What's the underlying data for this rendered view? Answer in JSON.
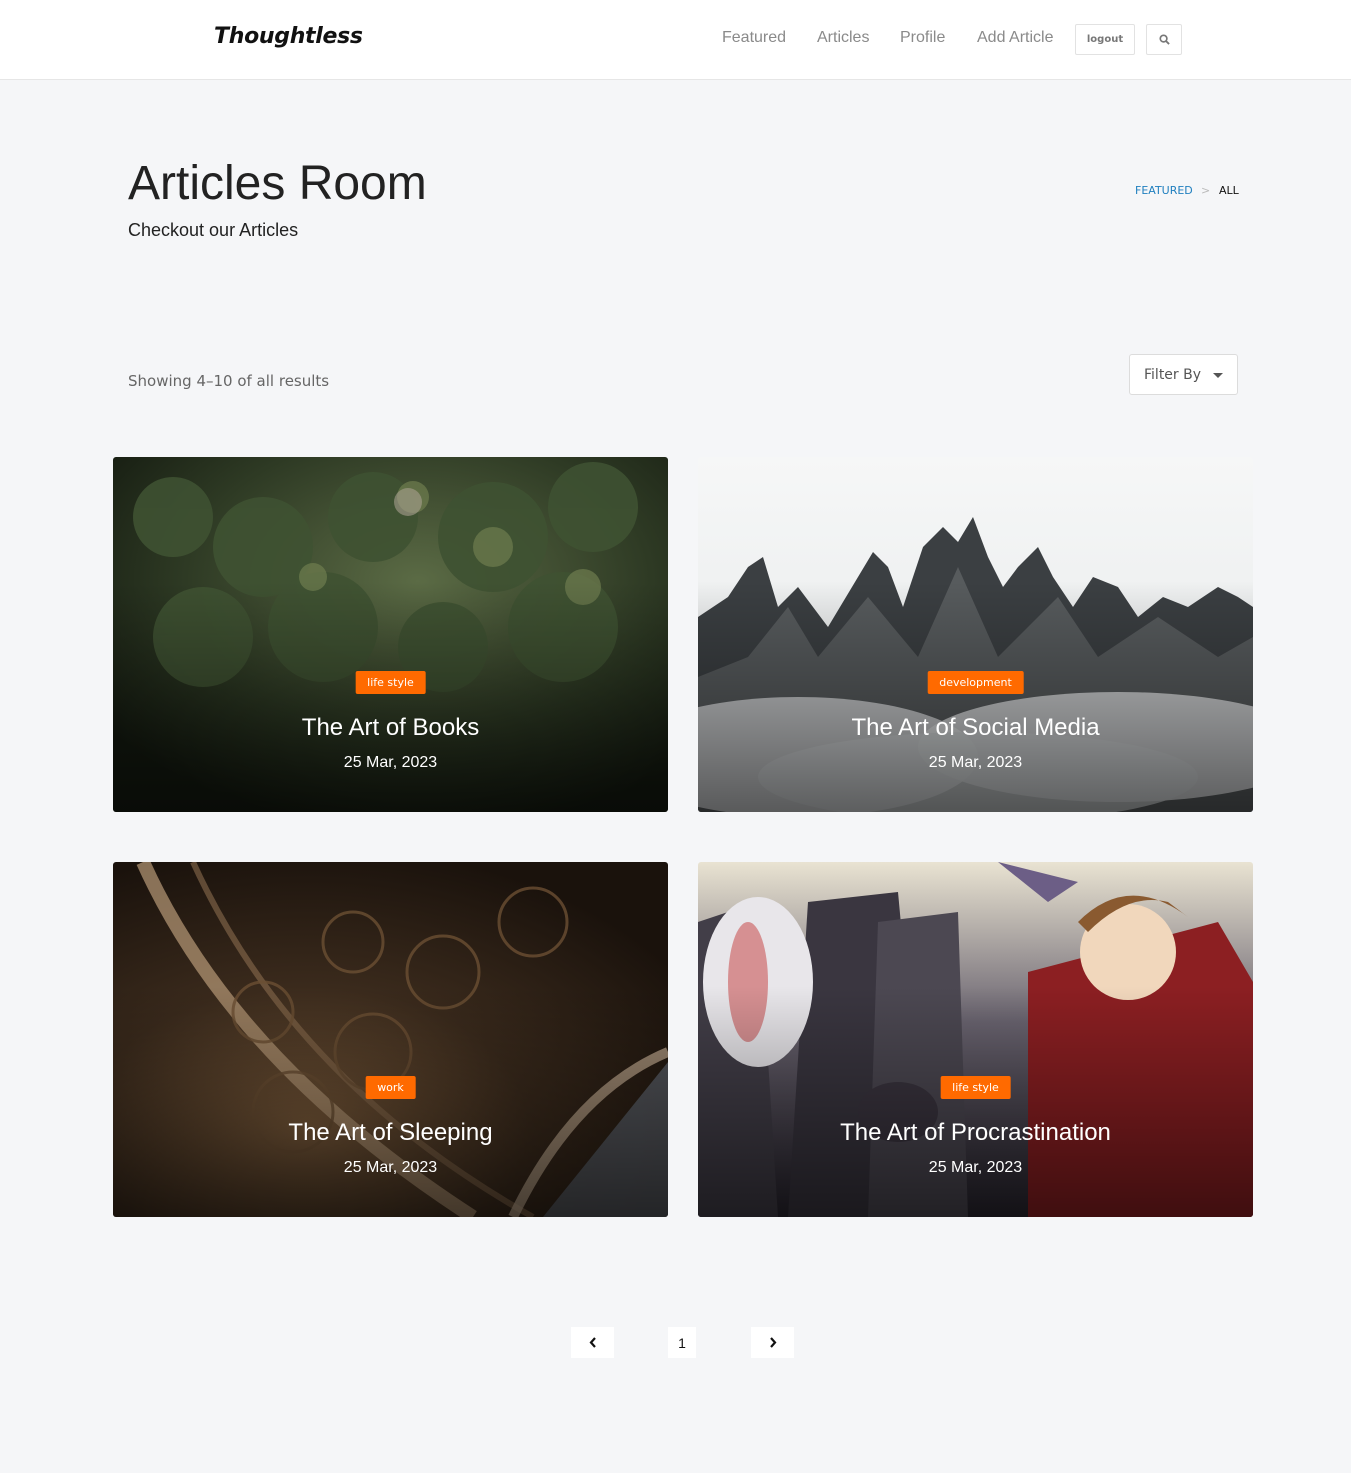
{
  "header": {
    "brand": "Thoughtless",
    "nav": [
      "Featured",
      "Articles",
      "Profile",
      "Add Article"
    ],
    "logout_label": "logout",
    "search_icon": "search-icon"
  },
  "hero": {
    "title": "Articles Room",
    "subtitle": "Checkout our Articles",
    "breadcrumb": {
      "featured": "FEATURED",
      "separator": ">",
      "current": "ALL"
    }
  },
  "toolbar": {
    "showing": "Showing 4–10 of all results",
    "filter_label": "Filter By"
  },
  "articles": [
    {
      "tag": "life style",
      "title": "The Art of Books",
      "date": "25 Mar, 2023"
    },
    {
      "tag": "development",
      "title": "The Art of Social Media",
      "date": "25 Mar, 2023"
    },
    {
      "tag": "work",
      "title": "The Art of Sleeping",
      "date": "25 Mar, 2023"
    },
    {
      "tag": "life style",
      "title": "The Art of Procrastination",
      "date": "25 Mar, 2023"
    }
  ],
  "pagination": {
    "current": "1",
    "prev_icon": "chevron-left-icon",
    "next_icon": "chevron-right-icon"
  },
  "colors": {
    "accent": "#ff6a00",
    "link": "#1f7fbf",
    "background": "#f5f6f8"
  }
}
